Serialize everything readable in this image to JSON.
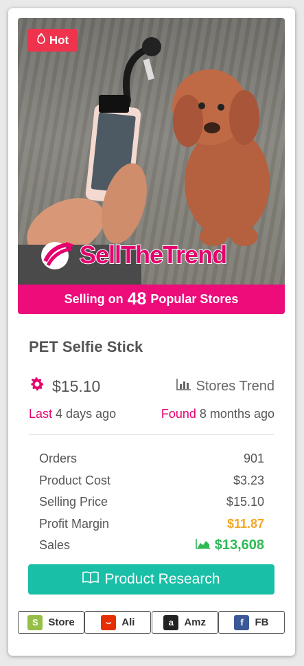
{
  "card": {
    "badge": "Hot",
    "logo_text": "SellTheTrend",
    "banner": {
      "prefix": "Selling on",
      "count": "48",
      "suffix": "Popular Stores"
    },
    "product_title": "PET Selfie Stick",
    "price": "$15.10",
    "stores_trend_label": "Stores Trend",
    "last": {
      "label": "Last",
      "value": "4 days ago"
    },
    "found": {
      "label": "Found",
      "value": "8 months ago"
    },
    "stats": [
      {
        "label": "Orders",
        "value": "901"
      },
      {
        "label": "Product Cost",
        "value": "$3.23"
      },
      {
        "label": "Selling Price",
        "value": "$15.10"
      },
      {
        "label": "Profit Margin",
        "value": "$11.87"
      },
      {
        "label": "Sales",
        "value": "$13,608"
      }
    ],
    "research_button": "Product Research",
    "markets": [
      {
        "label": "Store",
        "icon": "shopify-icon"
      },
      {
        "label": "Ali",
        "icon": "aliexpress-icon"
      },
      {
        "label": "Amz",
        "icon": "amazon-icon"
      },
      {
        "label": "FB",
        "icon": "facebook-icon"
      }
    ]
  },
  "colors": {
    "brand_pink": "#ec0c7a",
    "hot_red": "#f0334d",
    "teal": "#19bfa6",
    "orange": "#f5a623",
    "green": "#2fb957"
  }
}
